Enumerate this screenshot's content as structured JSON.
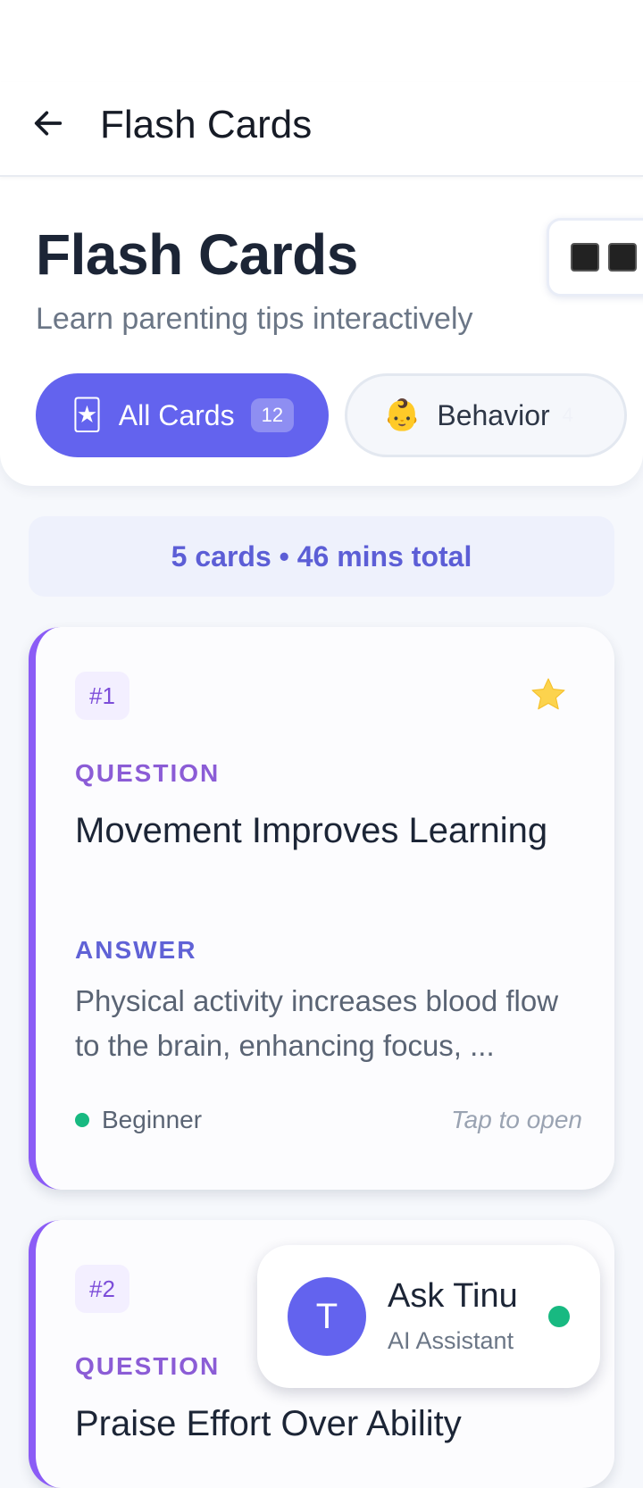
{
  "appbar": {
    "title": "Flash Cards",
    "back_icon": "arrow-left-icon"
  },
  "header": {
    "title": "Flash Cards",
    "subtitle": "Learn parenting tips interactively",
    "view_toggle_icon": "grid-view-icon"
  },
  "filters": [
    {
      "emoji": "🃏",
      "label": "All Cards",
      "count": "12",
      "selected": true
    },
    {
      "emoji": "👶",
      "label": "Behavior",
      "count": "4",
      "selected": false
    }
  ],
  "summary": "5 cards • 46 mins total",
  "cards": [
    {
      "number": "#1",
      "starred": true,
      "question_label": "QUESTION",
      "question": "Movement Improves Learning",
      "answer_label": "ANSWER",
      "answer": "Physical activity increases blood flow to the brain, enhancing focus, ...",
      "level": "Beginner",
      "hint": "Tap to open"
    },
    {
      "number": "#2",
      "question_label": "QUESTION",
      "question": "Praise Effort Over Ability"
    }
  ],
  "assistant": {
    "avatar_letter": "T",
    "name": "Ask Tinu",
    "role": "AI Assistant",
    "status": "online"
  },
  "colors": {
    "accent": "#6363ee",
    "card_border": "#8b5cf6",
    "success": "#18b981",
    "star": "#fcd34d"
  }
}
